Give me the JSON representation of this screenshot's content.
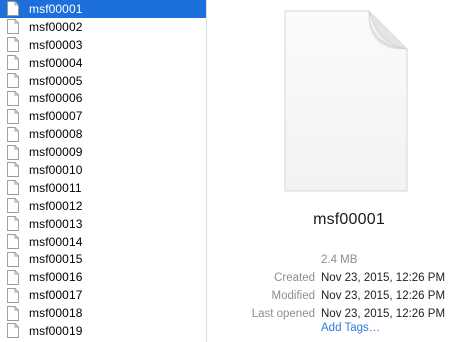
{
  "file_list": {
    "selected_index": 0,
    "items": [
      "msf00001",
      "msf00002",
      "msf00003",
      "msf00004",
      "msf00005",
      "msf00006",
      "msf00007",
      "msf00008",
      "msf00009",
      "msf00010",
      "msf00011",
      "msf00012",
      "msf00013",
      "msf00014",
      "msf00015",
      "msf00016",
      "msf00017",
      "msf00018",
      "msf00019"
    ],
    "item_icon": "document-icon"
  },
  "preview": {
    "icon": "document-icon",
    "filename": "msf00001",
    "size": "2.4 MB",
    "created_label": "Created",
    "created_value": "Nov 23, 2015, 12:26 PM",
    "modified_label": "Modified",
    "modified_value": "Nov 23, 2015, 12:26 PM",
    "last_opened_label": "Last opened",
    "last_opened_value": "Nov 23, 2015, 12:26 PM",
    "add_tags_label": "Add Tags…"
  },
  "colors": {
    "selection": "#1d6fdc",
    "link": "#2a7ae2",
    "label": "#8e8e8e"
  }
}
